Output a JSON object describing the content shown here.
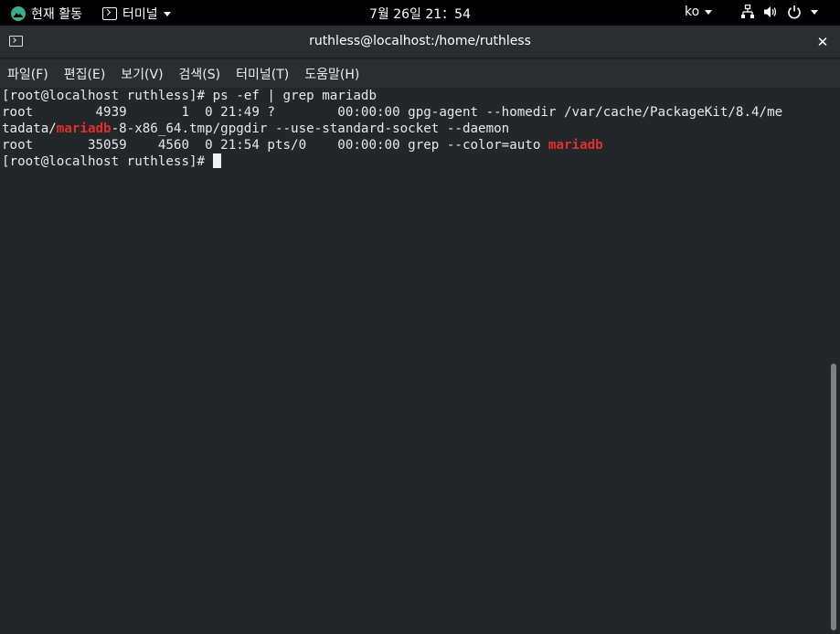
{
  "topbar": {
    "activities_label": "현재 활동",
    "app_menu_label": "터미널",
    "clock": "7월 26일 21：54",
    "lang": "ko"
  },
  "window": {
    "title": "ruthless@localhost:/home/ruthless",
    "close_glyph": "✕",
    "menu": [
      "파일(F)",
      "편집(E)",
      "보기(V)",
      "검색(S)",
      "터미널(T)",
      "도움말(H)"
    ]
  },
  "terminal": {
    "line1": "[root@localhost ruthless]# ps -ef | grep mariadb",
    "line2": "root        4939       1  0 21:49 ?        00:00:00 gpg-agent --homedir /var/cache/PackageKit/8.4/me",
    "line3_pre": "tadata/",
    "line3_hl": "mariadb",
    "line3_post": "-8-x86_64.tmp/gpgdir --use-standard-socket --daemon",
    "line4_pre": "root       35059    4560  0 21:54 pts/0    00:00:00 grep --color=auto ",
    "line4_hl": "mariadb",
    "prompt": "[root@localhost ruthless]# "
  },
  "colors": {
    "terminal_bg": "#232729",
    "highlight": "#e0302e",
    "titlebar_bg": "#2b2e30",
    "activities_logo": "#3dae8c"
  },
  "icons": [
    "rocky-logo-icon",
    "terminal-icon",
    "chevron-down-icon",
    "network-icon",
    "volume-icon",
    "power-icon",
    "close-icon"
  ]
}
